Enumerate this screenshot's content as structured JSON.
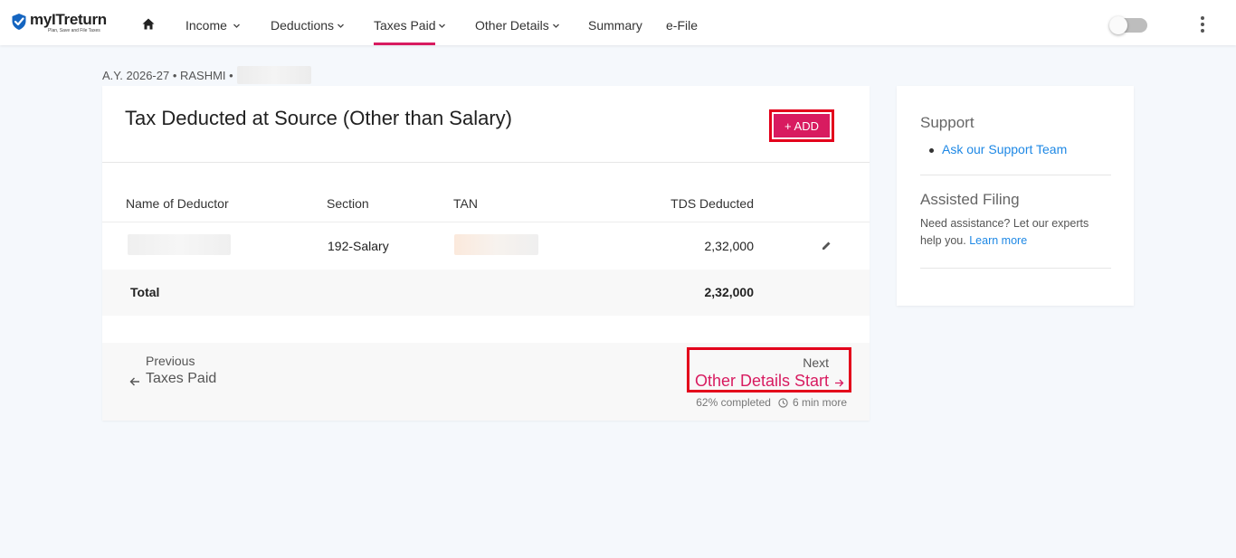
{
  "brand": {
    "name": "myITreturn",
    "tagline": "Plan, Save and File Taxes",
    "accent": "#d81b60",
    "highlight": "#e3001b"
  },
  "nav": {
    "income": "Income",
    "deductions": "Deductions",
    "taxes_paid": "Taxes Paid",
    "other_details": "Other Details",
    "summary": "Summary",
    "efile": "e-File"
  },
  "breadcrumb": {
    "text": "A.Y. 2026-27 • RASHMI •"
  },
  "card": {
    "title": "Tax Deducted at Source (Other than Salary)",
    "add_label": "+ ADD",
    "columns": {
      "name": "Name of Deductor",
      "section": "Section",
      "tan": "TAN",
      "tds": "TDS Deducted"
    },
    "rows": [
      {
        "section": "192-Salary",
        "tds": "2,32,000"
      }
    ],
    "total_label": "Total",
    "total_value": "2,32,000"
  },
  "footer": {
    "prev_label": "Previous",
    "prev_link": "Taxes Paid",
    "next_label": "Next",
    "next_link": "Other Details Start",
    "progress": "62% completed",
    "time_left": "6 min more"
  },
  "side": {
    "support_title": "Support",
    "support_link": "Ask our Support Team",
    "assisted_title": "Assisted Filing",
    "assisted_text": "Need assistance? Let our experts help you.",
    "learn_more": "Learn more"
  }
}
